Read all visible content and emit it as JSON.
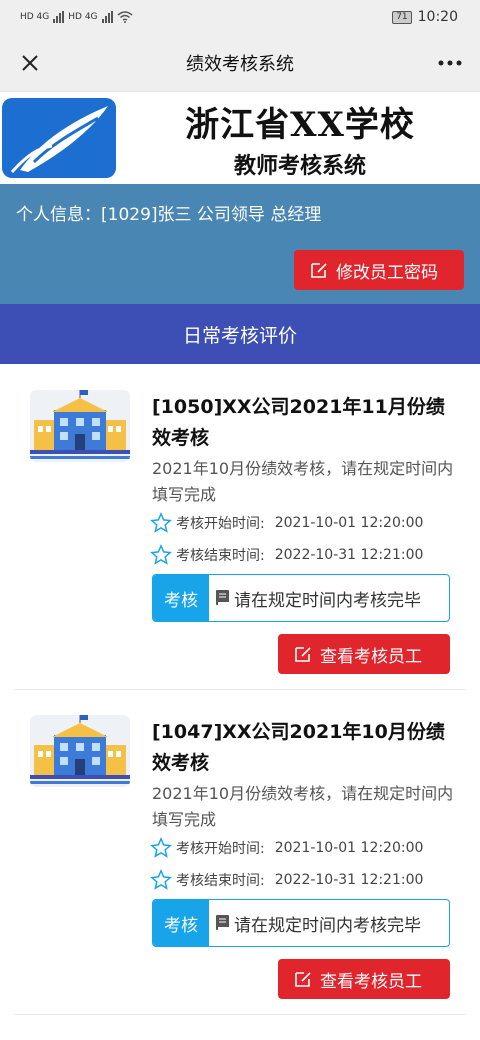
{
  "status_bar": {
    "network_left": "HD 4G",
    "network_right": "HD 4G",
    "battery": "71",
    "time": "10:20"
  },
  "nav": {
    "title": "绩效考核系统",
    "close_icon": "close-icon",
    "more_icon": "more-icon"
  },
  "banner": {
    "school_name": "浙江省XX学校",
    "system_name": "教师考核系统"
  },
  "info": {
    "text": "个人信息：[1029]张三 公司领导 总经理",
    "change_password_label": "修改员工密码"
  },
  "section": {
    "title": "日常考核评价"
  },
  "tasks": [
    {
      "title": "[1050]XX公司2021年11月份绩效考核",
      "description": "2021年10月份绩效考核，请在规定时间内填写完成",
      "start_label": "考核开始时间:",
      "start_time": "2021-10-01 12:20:00",
      "end_label": "考核结束时间:",
      "end_time": "2022-10-31 12:21:00",
      "tag": "考核",
      "status": "请在规定时间内考核完毕",
      "action_label": "查看考核员工"
    },
    {
      "title": "[1047]XX公司2021年10月份绩效考核",
      "description": "2021年10月份绩效考核，请在规定时间内填写完成",
      "start_label": "考核开始时间:",
      "start_time": "2021-10-01 12:20:00",
      "end_label": "考核结束时间:",
      "end_time": "2022-10-31 12:21:00",
      "tag": "考核",
      "status": "请在规定时间内考核完毕",
      "action_label": "查看考核员工"
    }
  ],
  "colors": {
    "info_panel": "#4a86b3",
    "section_header": "#3d4fb5",
    "primary_red": "#e0252d",
    "tag_blue": "#17a4e8"
  }
}
